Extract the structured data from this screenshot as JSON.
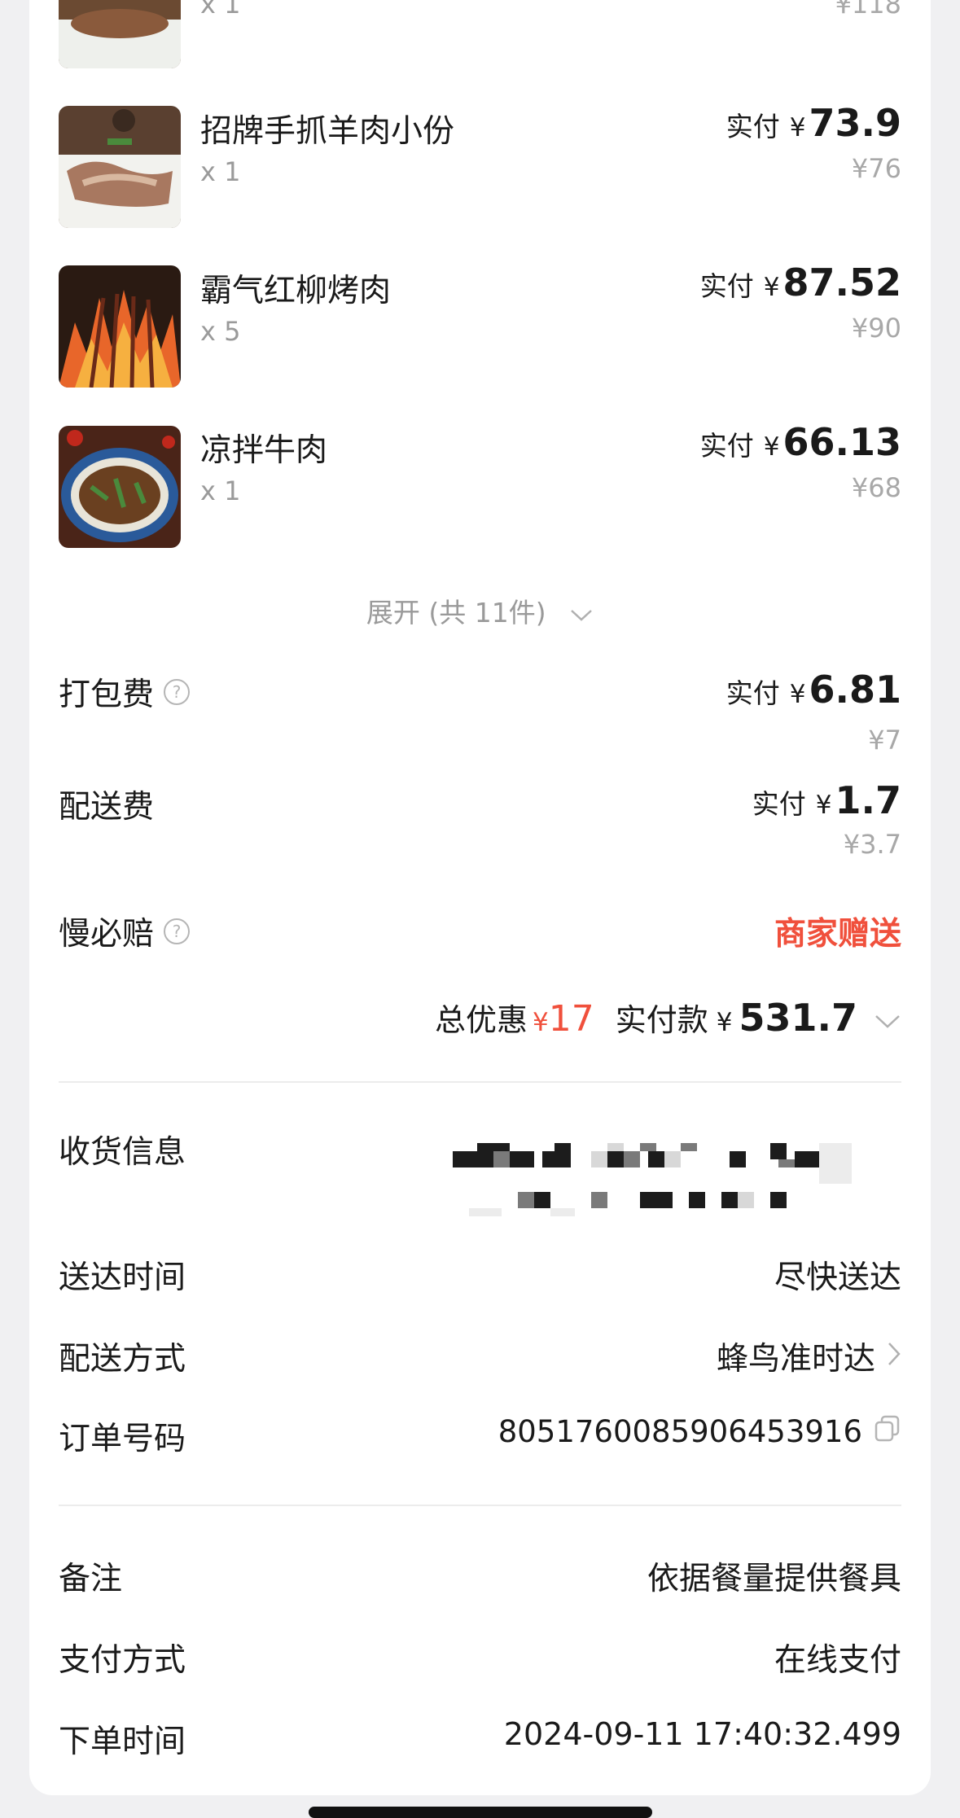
{
  "items": [
    {
      "name": "",
      "qty": "x 1",
      "orig": "¥118"
    },
    {
      "name": "招牌手抓羊肉小份",
      "qty": "x 1",
      "pay_label": "实付",
      "currency": "¥",
      "pay": "73.9",
      "orig": "¥76"
    },
    {
      "name": "霸气红柳烤肉",
      "qty": "x 5",
      "pay_label": "实付",
      "currency": "¥",
      "pay": "87.52",
      "orig": "¥90"
    },
    {
      "name": "凉拌牛肉",
      "qty": "x 1",
      "pay_label": "实付",
      "currency": "¥",
      "pay": "66.13",
      "orig": "¥68"
    }
  ],
  "expand_label": "展开 (共 11件)",
  "fees": {
    "packing": {
      "label": "打包费",
      "pay_label": "实付",
      "currency": "¥",
      "pay": "6.81",
      "orig": "¥7"
    },
    "delivery": {
      "label": "配送费",
      "pay_label": "实付",
      "currency": "¥",
      "pay": "1.7",
      "orig": "¥3.7"
    },
    "late_comp": {
      "label": "慢必赔",
      "value": "商家赠送"
    }
  },
  "totals": {
    "discount_label": "总优惠",
    "discount_currency": "¥",
    "discount": "17",
    "paid_label": "实付款",
    "paid_currency": "¥",
    "paid": "531.7"
  },
  "info": {
    "receiver_label": "收货信息",
    "delivery_time_label": "送达时间",
    "delivery_time": "尽快送达",
    "delivery_method_label": "配送方式",
    "delivery_method": "蜂鸟准时达",
    "order_no_label": "订单号码",
    "order_no": "8051760085906453916"
  },
  "extra": {
    "remark_label": "备注",
    "remark": "依据餐量提供餐具",
    "payment_label": "支付方式",
    "payment": "在线支付",
    "order_time_label": "下单时间",
    "order_time": "2024-09-11 17:40:32.499"
  },
  "colors": {
    "accent_red": "#f0503c",
    "text": "#1a1a1a",
    "muted": "#9a9a9a",
    "background": "#f0f0f2"
  }
}
